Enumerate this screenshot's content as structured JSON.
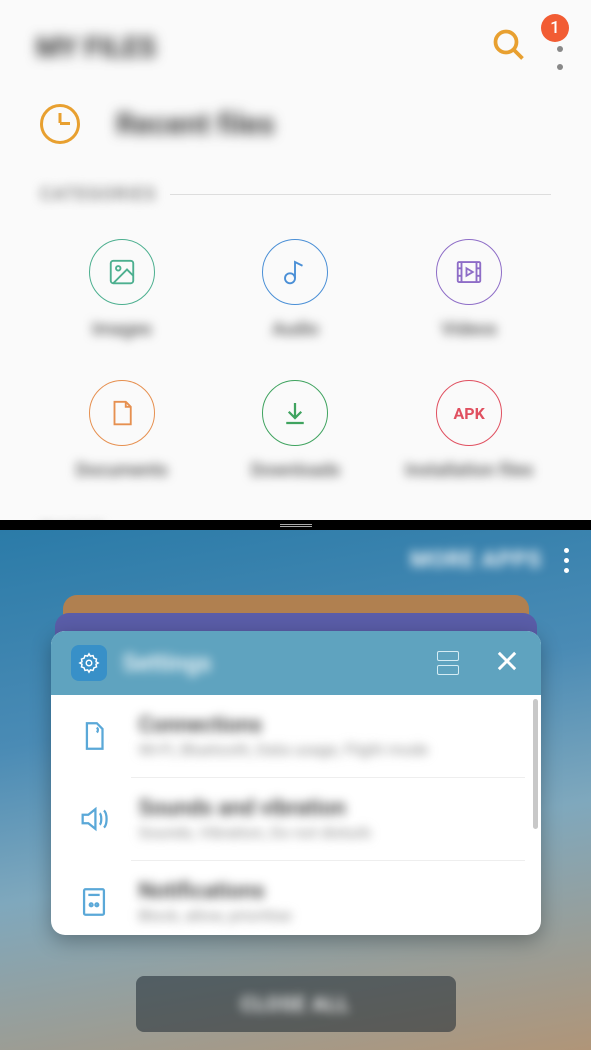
{
  "header": {
    "title": "MY FILES",
    "badge_count": "1"
  },
  "recent": {
    "label": "Recent files"
  },
  "sections": {
    "categories_label": "CATEGORIES",
    "phone_label": "PHONE"
  },
  "categories": [
    {
      "label": "Images"
    },
    {
      "label": "Audio"
    },
    {
      "label": "Videos"
    },
    {
      "label": "Documents"
    },
    {
      "label": "Downloads"
    },
    {
      "label": "Installation files",
      "badge": "APK"
    }
  ],
  "recents": {
    "more_apps": "MORE APPS",
    "card_title": "Settings",
    "close_all": "CLOSE ALL",
    "items": [
      {
        "title": "Connections",
        "sub": "Wi-Fi, Bluetooth, Data usage, Flight mode"
      },
      {
        "title": "Sounds and vibration",
        "sub": "Sounds, Vibration, Do not disturb"
      },
      {
        "title": "Notifications",
        "sub": "Block, allow, prioritise"
      }
    ]
  }
}
